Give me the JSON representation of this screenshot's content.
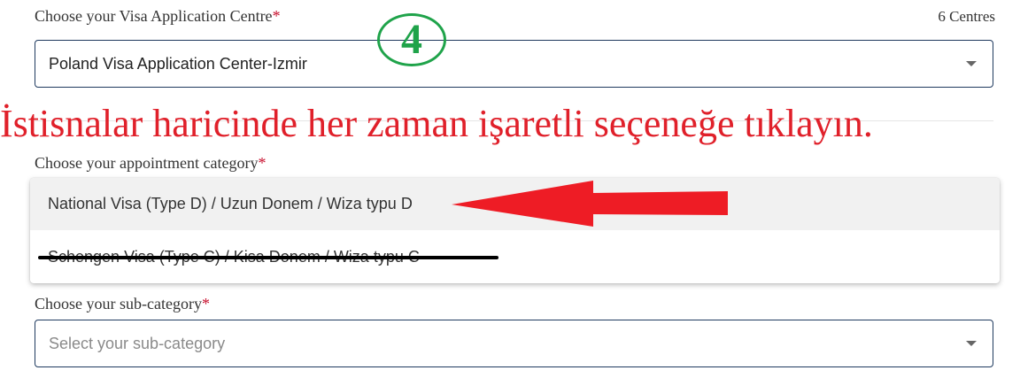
{
  "visa_centre": {
    "label": "Choose your Visa Application Centre",
    "required_mark": "*",
    "count": "6 Centres",
    "selected": "Poland Visa Application Center-Izmir"
  },
  "annotation": {
    "step_number": "4",
    "instruction": "İstisnalar haricinde her zaman işaretli seçeneğe tıklayın.",
    "text_color": "#e0202a",
    "step_color": "#1fa34a"
  },
  "appointment_category": {
    "label": "Choose your appointment category",
    "required_mark": "*",
    "options": [
      "National Visa (Type D) / Uzun Donem / Wiza typu D",
      "Schengen Visa (Type C) / Kisa Donem / Wiza typu C"
    ]
  },
  "sub_category": {
    "label": "Choose your sub-category",
    "required_mark": "*",
    "placeholder": "Select your sub-category"
  }
}
